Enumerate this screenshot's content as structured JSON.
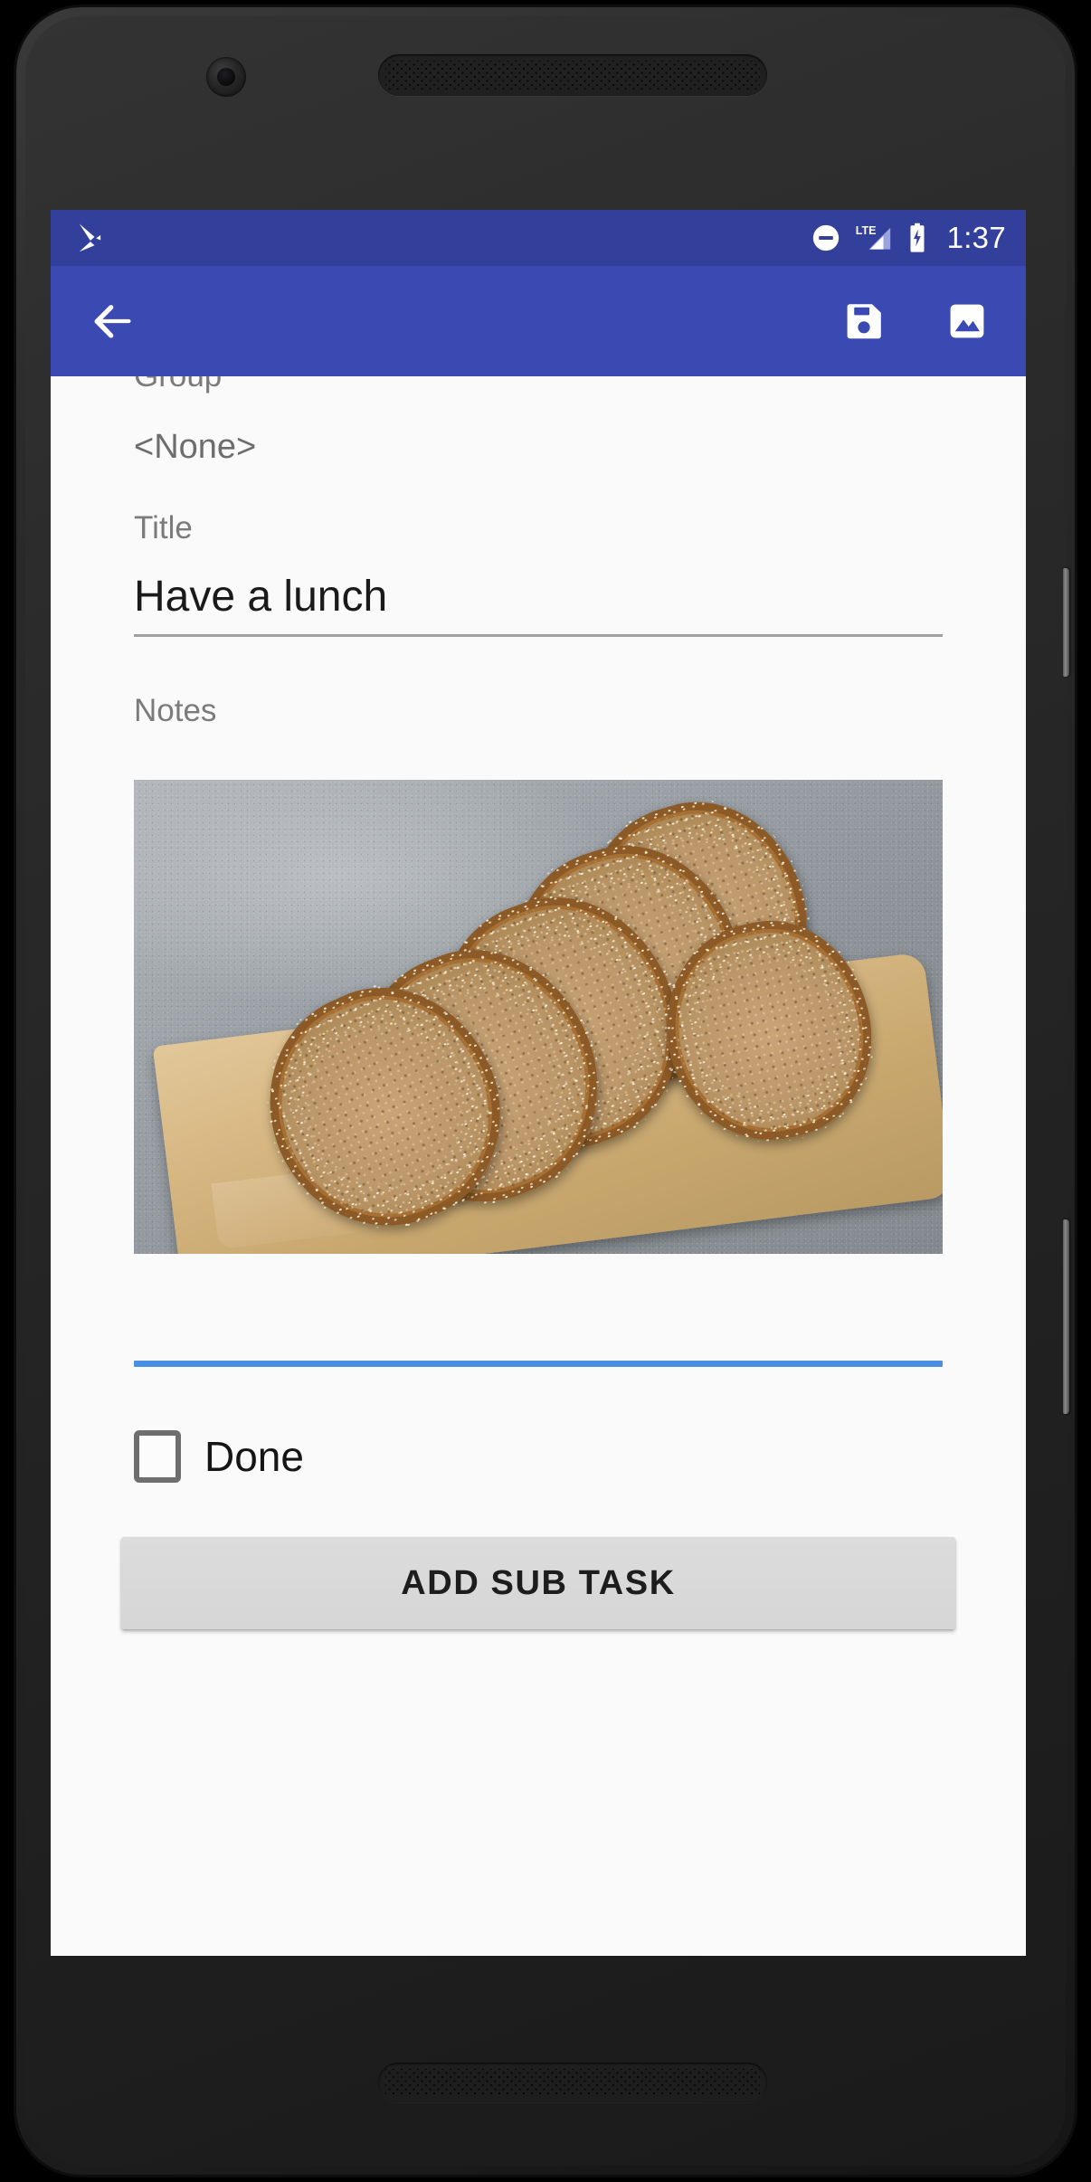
{
  "status_bar": {
    "app_icon": "google-play-icon",
    "dnd_icon": "do-not-disturb-icon",
    "network_label": "LTE",
    "signal_icon": "cellular-signal-icon",
    "battery_icon": "battery-charging-icon",
    "clock": "1:37",
    "background_color": "#32409c"
  },
  "app_bar": {
    "back_icon": "arrow-back-icon",
    "save_icon": "save-floppy-disk-icon",
    "image_icon": "insert-photo-icon",
    "background_color": "#3b4ab3"
  },
  "form": {
    "group_label": "Group",
    "group_value": "<None>",
    "title_label": "Title",
    "title_value": "Have a lunch",
    "notes_label": "Notes",
    "notes_image_alt": "sliced sesame seed bread loaf on a wooden cutting board",
    "divider_color": "#4a90e2"
  },
  "done": {
    "label": "Done",
    "checked": false
  },
  "actions": {
    "add_subtask_label": "ADD SUB TASK"
  },
  "nav_bar": {
    "back_icon": "nav-back-triangle-icon",
    "home_icon": "nav-home-circle-icon",
    "recents_icon": "nav-recents-square-icon"
  }
}
